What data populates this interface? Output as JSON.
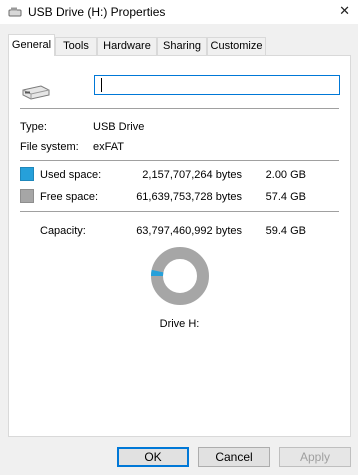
{
  "window": {
    "title": "USB Drive (H:) Properties",
    "close_glyph": "✕"
  },
  "tabs": [
    {
      "label": "General",
      "active": true
    },
    {
      "label": "Tools",
      "active": false
    },
    {
      "label": "Hardware",
      "active": false
    },
    {
      "label": "Sharing",
      "active": false
    },
    {
      "label": "Customize",
      "active": false
    }
  ],
  "general": {
    "name_value": "",
    "type_label": "Type:",
    "type_value": "USB Drive",
    "fs_label": "File system:",
    "fs_value": "exFAT",
    "used": {
      "label": "Used space:",
      "bytes": "2,157,707,264 bytes",
      "size": "2.00 GB",
      "color": "#26a0da"
    },
    "free": {
      "label": "Free space:",
      "bytes": "61,639,753,728 bytes",
      "size": "57.4 GB",
      "color": "#a6a6a6"
    },
    "capacity": {
      "label": "Capacity:",
      "bytes": "63,797,460,992 bytes",
      "size": "59.4 GB"
    },
    "used_fraction": 0.034,
    "drive_label": "Drive H:"
  },
  "buttons": {
    "ok": "OK",
    "cancel": "Cancel",
    "apply": "Apply"
  }
}
